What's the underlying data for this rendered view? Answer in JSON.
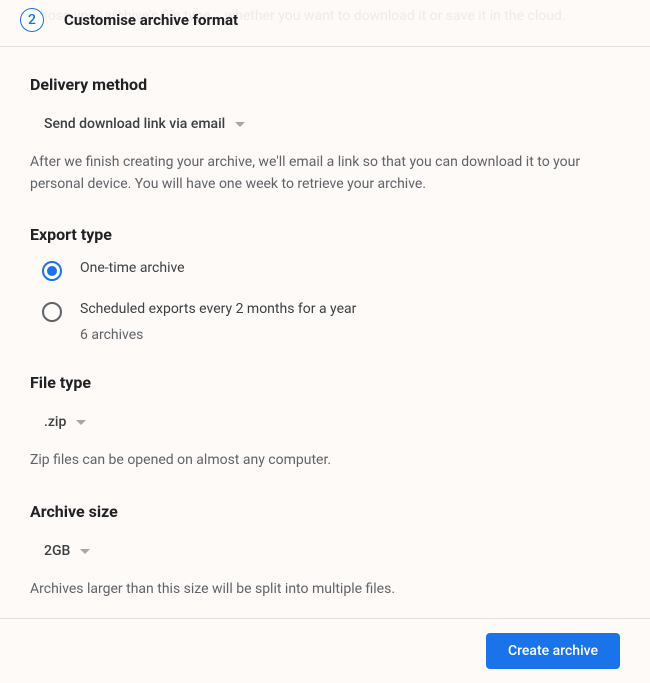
{
  "header": {
    "step_number": "2",
    "title": "Customise archive format",
    "ghost": "hose your archive's file type... whether you want to download it or save it in the cloud."
  },
  "delivery": {
    "title": "Delivery method",
    "selected": "Send download link via email",
    "description": "After we finish creating your archive, we'll email a link so that you can download it to your personal device. You will have one week to retrieve your archive."
  },
  "export_type": {
    "title": "Export type",
    "options": [
      {
        "label": "One-time archive",
        "selected": true
      },
      {
        "label": "Scheduled exports every 2 months for a year",
        "selected": false,
        "sublabel": "6 archives"
      }
    ]
  },
  "file_type": {
    "title": "File type",
    "selected": ".zip",
    "description": "Zip files can be opened on almost any computer."
  },
  "archive_size": {
    "title": "Archive size",
    "selected": "2GB",
    "description": "Archives larger than this size will be split into multiple files."
  },
  "footer": {
    "create_label": "Create archive"
  }
}
